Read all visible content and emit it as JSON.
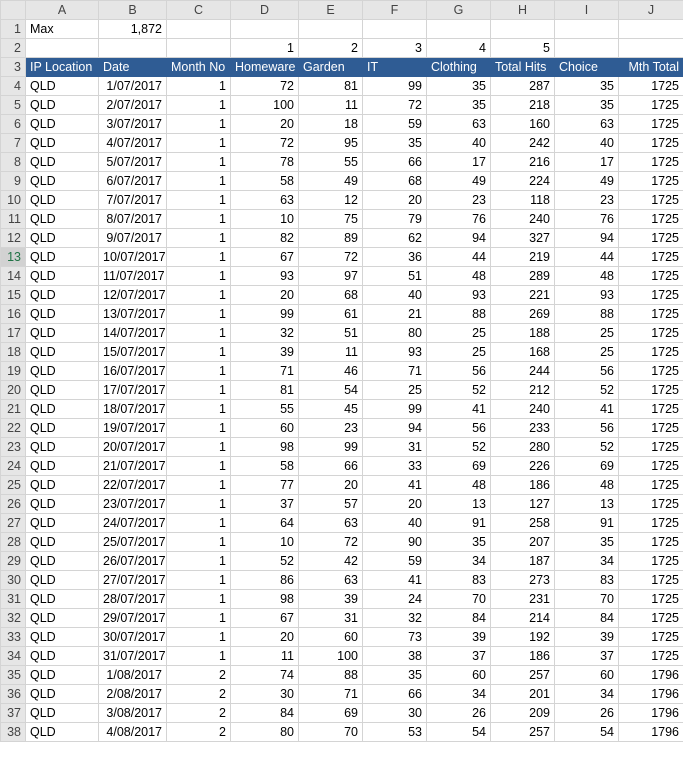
{
  "columns": [
    "A",
    "B",
    "C",
    "D",
    "E",
    "F",
    "G",
    "H",
    "I",
    "J"
  ],
  "row1": {
    "a": "Max",
    "b": "1,872"
  },
  "row2": {
    "d": "1",
    "e": "2",
    "f": "3",
    "g": "4",
    "h": "5"
  },
  "headers": [
    "IP Location",
    "Date",
    "Month No",
    "Homeware",
    "Garden",
    "IT",
    "Clothing",
    "Total Hits",
    "Choice",
    "Mth Total"
  ],
  "active_row": 13,
  "header_color": "#2f5c94",
  "rows": [
    {
      "n": 4,
      "loc": "QLD",
      "date": "1/07/2017",
      "m": "1",
      "hw": "72",
      "gd": "81",
      "it": "99",
      "cl": "35",
      "tot": "287",
      "ch": "35",
      "mt": "1725"
    },
    {
      "n": 5,
      "loc": "QLD",
      "date": "2/07/2017",
      "m": "1",
      "hw": "100",
      "gd": "11",
      "it": "72",
      "cl": "35",
      "tot": "218",
      "ch": "35",
      "mt": "1725"
    },
    {
      "n": 6,
      "loc": "QLD",
      "date": "3/07/2017",
      "m": "1",
      "hw": "20",
      "gd": "18",
      "it": "59",
      "cl": "63",
      "tot": "160",
      "ch": "63",
      "mt": "1725"
    },
    {
      "n": 7,
      "loc": "QLD",
      "date": "4/07/2017",
      "m": "1",
      "hw": "72",
      "gd": "95",
      "it": "35",
      "cl": "40",
      "tot": "242",
      "ch": "40",
      "mt": "1725"
    },
    {
      "n": 8,
      "loc": "QLD",
      "date": "5/07/2017",
      "m": "1",
      "hw": "78",
      "gd": "55",
      "it": "66",
      "cl": "17",
      "tot": "216",
      "ch": "17",
      "mt": "1725"
    },
    {
      "n": 9,
      "loc": "QLD",
      "date": "6/07/2017",
      "m": "1",
      "hw": "58",
      "gd": "49",
      "it": "68",
      "cl": "49",
      "tot": "224",
      "ch": "49",
      "mt": "1725"
    },
    {
      "n": 10,
      "loc": "QLD",
      "date": "7/07/2017",
      "m": "1",
      "hw": "63",
      "gd": "12",
      "it": "20",
      "cl": "23",
      "tot": "118",
      "ch": "23",
      "mt": "1725"
    },
    {
      "n": 11,
      "loc": "QLD",
      "date": "8/07/2017",
      "m": "1",
      "hw": "10",
      "gd": "75",
      "it": "79",
      "cl": "76",
      "tot": "240",
      "ch": "76",
      "mt": "1725"
    },
    {
      "n": 12,
      "loc": "QLD",
      "date": "9/07/2017",
      "m": "1",
      "hw": "82",
      "gd": "89",
      "it": "62",
      "cl": "94",
      "tot": "327",
      "ch": "94",
      "mt": "1725"
    },
    {
      "n": 13,
      "loc": "QLD",
      "date": "10/07/2017",
      "m": "1",
      "hw": "67",
      "gd": "72",
      "it": "36",
      "cl": "44",
      "tot": "219",
      "ch": "44",
      "mt": "1725"
    },
    {
      "n": 14,
      "loc": "QLD",
      "date": "11/07/2017",
      "m": "1",
      "hw": "93",
      "gd": "97",
      "it": "51",
      "cl": "48",
      "tot": "289",
      "ch": "48",
      "mt": "1725"
    },
    {
      "n": 15,
      "loc": "QLD",
      "date": "12/07/2017",
      "m": "1",
      "hw": "20",
      "gd": "68",
      "it": "40",
      "cl": "93",
      "tot": "221",
      "ch": "93",
      "mt": "1725"
    },
    {
      "n": 16,
      "loc": "QLD",
      "date": "13/07/2017",
      "m": "1",
      "hw": "99",
      "gd": "61",
      "it": "21",
      "cl": "88",
      "tot": "269",
      "ch": "88",
      "mt": "1725"
    },
    {
      "n": 17,
      "loc": "QLD",
      "date": "14/07/2017",
      "m": "1",
      "hw": "32",
      "gd": "51",
      "it": "80",
      "cl": "25",
      "tot": "188",
      "ch": "25",
      "mt": "1725"
    },
    {
      "n": 18,
      "loc": "QLD",
      "date": "15/07/2017",
      "m": "1",
      "hw": "39",
      "gd": "11",
      "it": "93",
      "cl": "25",
      "tot": "168",
      "ch": "25",
      "mt": "1725"
    },
    {
      "n": 19,
      "loc": "QLD",
      "date": "16/07/2017",
      "m": "1",
      "hw": "71",
      "gd": "46",
      "it": "71",
      "cl": "56",
      "tot": "244",
      "ch": "56",
      "mt": "1725"
    },
    {
      "n": 20,
      "loc": "QLD",
      "date": "17/07/2017",
      "m": "1",
      "hw": "81",
      "gd": "54",
      "it": "25",
      "cl": "52",
      "tot": "212",
      "ch": "52",
      "mt": "1725"
    },
    {
      "n": 21,
      "loc": "QLD",
      "date": "18/07/2017",
      "m": "1",
      "hw": "55",
      "gd": "45",
      "it": "99",
      "cl": "41",
      "tot": "240",
      "ch": "41",
      "mt": "1725"
    },
    {
      "n": 22,
      "loc": "QLD",
      "date": "19/07/2017",
      "m": "1",
      "hw": "60",
      "gd": "23",
      "it": "94",
      "cl": "56",
      "tot": "233",
      "ch": "56",
      "mt": "1725"
    },
    {
      "n": 23,
      "loc": "QLD",
      "date": "20/07/2017",
      "m": "1",
      "hw": "98",
      "gd": "99",
      "it": "31",
      "cl": "52",
      "tot": "280",
      "ch": "52",
      "mt": "1725"
    },
    {
      "n": 24,
      "loc": "QLD",
      "date": "21/07/2017",
      "m": "1",
      "hw": "58",
      "gd": "66",
      "it": "33",
      "cl": "69",
      "tot": "226",
      "ch": "69",
      "mt": "1725"
    },
    {
      "n": 25,
      "loc": "QLD",
      "date": "22/07/2017",
      "m": "1",
      "hw": "77",
      "gd": "20",
      "it": "41",
      "cl": "48",
      "tot": "186",
      "ch": "48",
      "mt": "1725"
    },
    {
      "n": 26,
      "loc": "QLD",
      "date": "23/07/2017",
      "m": "1",
      "hw": "37",
      "gd": "57",
      "it": "20",
      "cl": "13",
      "tot": "127",
      "ch": "13",
      "mt": "1725"
    },
    {
      "n": 27,
      "loc": "QLD",
      "date": "24/07/2017",
      "m": "1",
      "hw": "64",
      "gd": "63",
      "it": "40",
      "cl": "91",
      "tot": "258",
      "ch": "91",
      "mt": "1725"
    },
    {
      "n": 28,
      "loc": "QLD",
      "date": "25/07/2017",
      "m": "1",
      "hw": "10",
      "gd": "72",
      "it": "90",
      "cl": "35",
      "tot": "207",
      "ch": "35",
      "mt": "1725"
    },
    {
      "n": 29,
      "loc": "QLD",
      "date": "26/07/2017",
      "m": "1",
      "hw": "52",
      "gd": "42",
      "it": "59",
      "cl": "34",
      "tot": "187",
      "ch": "34",
      "mt": "1725"
    },
    {
      "n": 30,
      "loc": "QLD",
      "date": "27/07/2017",
      "m": "1",
      "hw": "86",
      "gd": "63",
      "it": "41",
      "cl": "83",
      "tot": "273",
      "ch": "83",
      "mt": "1725"
    },
    {
      "n": 31,
      "loc": "QLD",
      "date": "28/07/2017",
      "m": "1",
      "hw": "98",
      "gd": "39",
      "it": "24",
      "cl": "70",
      "tot": "231",
      "ch": "70",
      "mt": "1725"
    },
    {
      "n": 32,
      "loc": "QLD",
      "date": "29/07/2017",
      "m": "1",
      "hw": "67",
      "gd": "31",
      "it": "32",
      "cl": "84",
      "tot": "214",
      "ch": "84",
      "mt": "1725"
    },
    {
      "n": 33,
      "loc": "QLD",
      "date": "30/07/2017",
      "m": "1",
      "hw": "20",
      "gd": "60",
      "it": "73",
      "cl": "39",
      "tot": "192",
      "ch": "39",
      "mt": "1725"
    },
    {
      "n": 34,
      "loc": "QLD",
      "date": "31/07/2017",
      "m": "1",
      "hw": "11",
      "gd": "100",
      "it": "38",
      "cl": "37",
      "tot": "186",
      "ch": "37",
      "mt": "1725"
    },
    {
      "n": 35,
      "loc": "QLD",
      "date": "1/08/2017",
      "m": "2",
      "hw": "74",
      "gd": "88",
      "it": "35",
      "cl": "60",
      "tot": "257",
      "ch": "60",
      "mt": "1796"
    },
    {
      "n": 36,
      "loc": "QLD",
      "date": "2/08/2017",
      "m": "2",
      "hw": "30",
      "gd": "71",
      "it": "66",
      "cl": "34",
      "tot": "201",
      "ch": "34",
      "mt": "1796"
    },
    {
      "n": 37,
      "loc": "QLD",
      "date": "3/08/2017",
      "m": "2",
      "hw": "84",
      "gd": "69",
      "it": "30",
      "cl": "26",
      "tot": "209",
      "ch": "26",
      "mt": "1796"
    },
    {
      "n": 38,
      "loc": "QLD",
      "date": "4/08/2017",
      "m": "2",
      "hw": "80",
      "gd": "70",
      "it": "53",
      "cl": "54",
      "tot": "257",
      "ch": "54",
      "mt": "1796"
    }
  ]
}
